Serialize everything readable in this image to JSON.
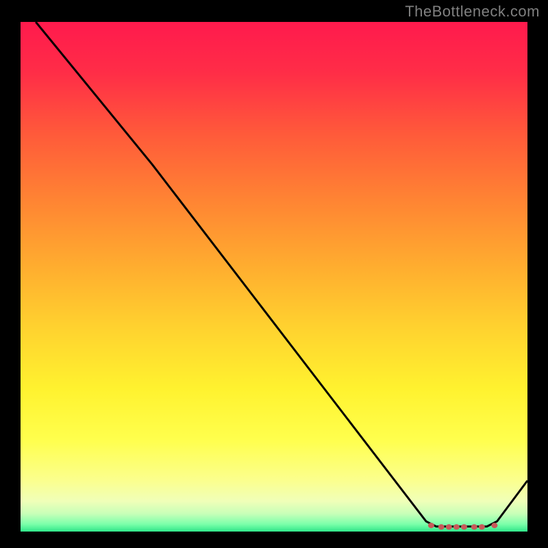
{
  "attribution": "TheBottleneck.com",
  "chart_data": {
    "type": "line",
    "title": "",
    "xlabel": "",
    "ylabel": "",
    "xlim": [
      0,
      100
    ],
    "ylim": [
      0,
      100
    ],
    "series": [
      {
        "name": "curve",
        "color": "#000000",
        "points": [
          {
            "x": 3,
            "y": 100
          },
          {
            "x": 26,
            "y": 72
          },
          {
            "x": 80,
            "y": 2
          },
          {
            "x": 82,
            "y": 1
          },
          {
            "x": 92,
            "y": 1
          },
          {
            "x": 94,
            "y": 2
          },
          {
            "x": 100,
            "y": 10
          }
        ]
      }
    ],
    "markers": [
      {
        "x": 81,
        "y": 1.2
      },
      {
        "x": 83,
        "y": 0.9
      },
      {
        "x": 84.5,
        "y": 0.9
      },
      {
        "x": 86,
        "y": 0.9
      },
      {
        "x": 87.5,
        "y": 0.9
      },
      {
        "x": 89.5,
        "y": 0.9
      },
      {
        "x": 91,
        "y": 0.9
      },
      {
        "x": 93.5,
        "y": 1.2
      }
    ],
    "marker_color": "#c85a5a",
    "gradient_stops": [
      {
        "offset": 0.0,
        "color": "#ff1a4d"
      },
      {
        "offset": 0.1,
        "color": "#ff2d47"
      },
      {
        "offset": 0.22,
        "color": "#ff5a3a"
      },
      {
        "offset": 0.35,
        "color": "#ff8433"
      },
      {
        "offset": 0.48,
        "color": "#ffad2f"
      },
      {
        "offset": 0.6,
        "color": "#ffd22f"
      },
      {
        "offset": 0.72,
        "color": "#fff22f"
      },
      {
        "offset": 0.82,
        "color": "#ffff4d"
      },
      {
        "offset": 0.9,
        "color": "#fbff8e"
      },
      {
        "offset": 0.94,
        "color": "#f0ffb8"
      },
      {
        "offset": 0.965,
        "color": "#c8ffb8"
      },
      {
        "offset": 0.985,
        "color": "#7dffab"
      },
      {
        "offset": 1.0,
        "color": "#30e88a"
      }
    ]
  }
}
